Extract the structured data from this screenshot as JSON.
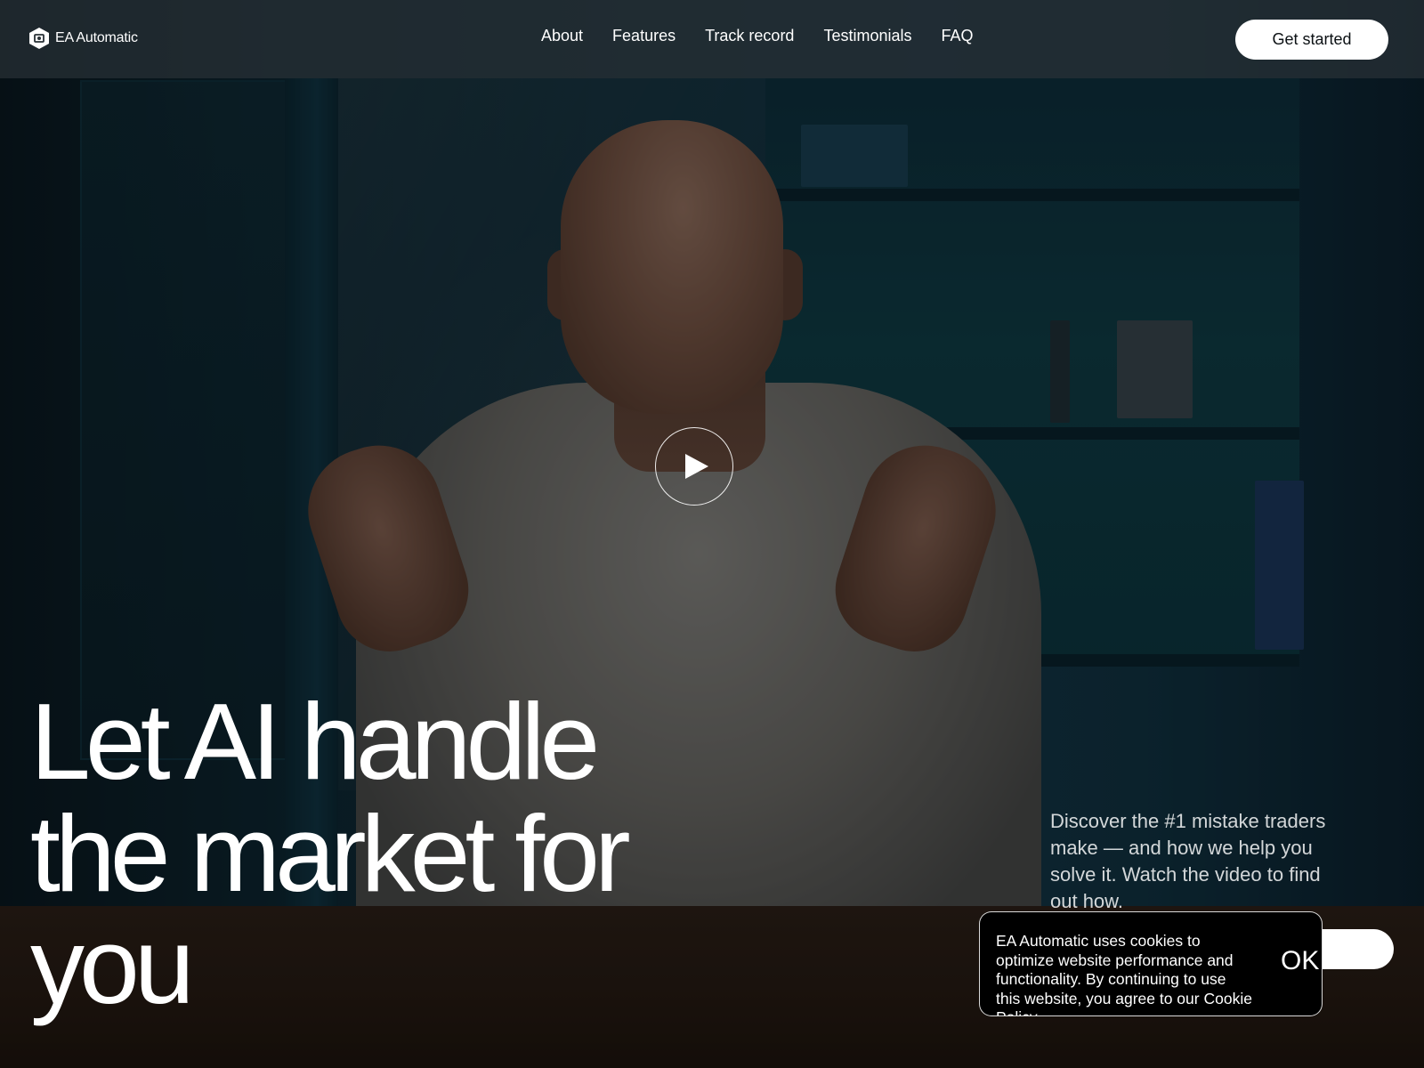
{
  "brand": {
    "name": "EA Automatic",
    "logo_icon": "hexagon-logo-icon"
  },
  "nav": {
    "items": [
      "About",
      "Features",
      "Track record",
      "Testimonials",
      "FAQ"
    ]
  },
  "header": {
    "cta_label": "Get started"
  },
  "video": {
    "play_icon": "play-icon"
  },
  "hero": {
    "headline_lines": [
      "Let AI handle",
      "the market for",
      "you"
    ],
    "subtext": "Discover the #1 mistake traders make — and how we help you solve it. Watch the video to find out how."
  },
  "cookie": {
    "text": "EA Automatic uses cookies to optimize website performance and functionality. By continuing to use this website, you agree to our Cookie Policy.",
    "ok_label": "OK"
  },
  "colors": {
    "header_bg": "#283036",
    "cta_bg": "#ffffff",
    "cta_text": "#0c1114",
    "cookie_bg": "#000000"
  }
}
